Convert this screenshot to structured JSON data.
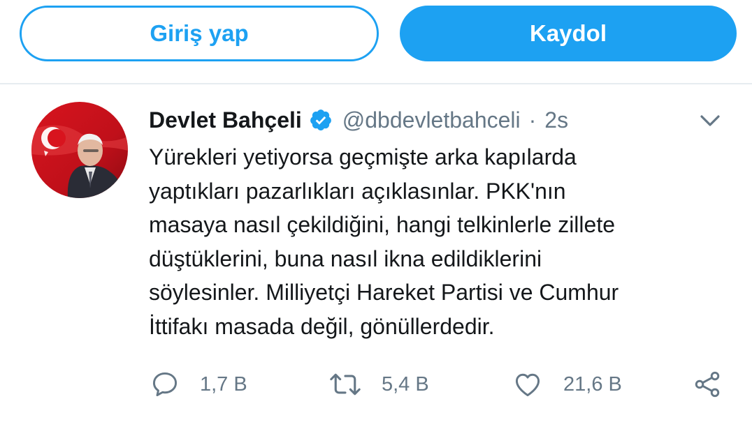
{
  "header": {
    "login_label": "Giriş yap",
    "signup_label": "Kaydol"
  },
  "tweet": {
    "author_name": "Devlet Bahçeli",
    "handle": "@dbdevletbahceli",
    "separator": "·",
    "time": "2s",
    "body_lines": [
      "Yürekleri yetiyorsa geçmişte arka kapılarda",
      "yaptıkları pazarlıkları açıklasınlar. PKK'nın",
      "masaya nasıl çekildiğini, hangi telkinlerle zillete",
      "düştüklerini, buna nasıl ikna edildiklerini",
      "söylesinler. Milliyetçi Hareket Partisi ve Cumhur",
      "İttifakı masada değil, gönüllerdedir."
    ],
    "actions": {
      "reply_count": "1,7 B",
      "retweet_count": "5,4 B",
      "like_count": "21,6 B"
    }
  },
  "icons": {
    "verified": "verified-badge-icon",
    "caret": "chevron-down-icon",
    "reply": "reply-icon",
    "retweet": "retweet-icon",
    "like": "heart-icon",
    "share": "share-icon"
  },
  "colors": {
    "accent": "#1da1f2",
    "secondary_text": "#657786",
    "primary_text": "#14171a",
    "divider": "#e6ecf0"
  }
}
